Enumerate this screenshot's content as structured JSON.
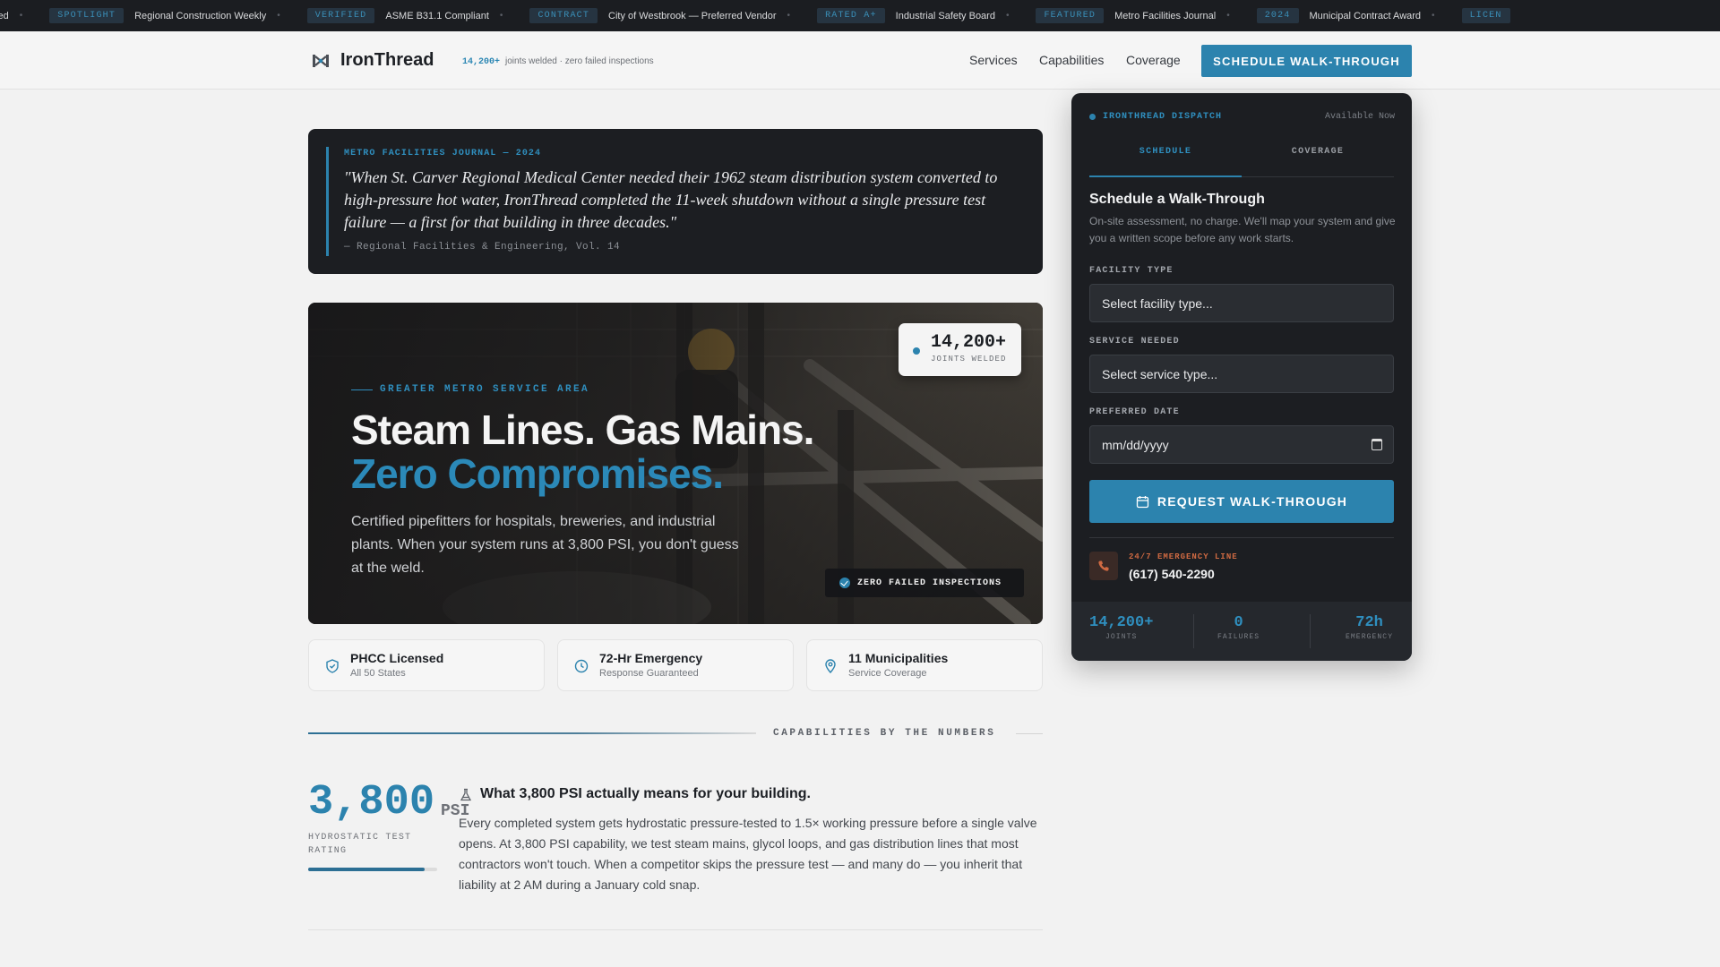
{
  "ticker": [
    {
      "tag": "",
      "text": "ved"
    },
    {
      "tag": "SPOTLIGHT",
      "text": "Regional Construction Weekly"
    },
    {
      "tag": "VERIFIED",
      "text": "ASME B31.1 Compliant"
    },
    {
      "tag": "CONTRACT",
      "text": "City of Westbrook — Preferred Vendor"
    },
    {
      "tag": "RATED A+",
      "text": "Industrial Safety Board"
    },
    {
      "tag": "FEATURED",
      "text": "Metro Facilities Journal"
    },
    {
      "tag": "2024",
      "text": "Municipal Contract Award"
    },
    {
      "tag": "LICEN",
      "text": ""
    }
  ],
  "header": {
    "brand": "IronThread",
    "stat_value": "14,200+",
    "stat_text": "joints welded · zero failed inspections",
    "nav": [
      "Services",
      "Capabilities",
      "Coverage"
    ],
    "cta": "SCHEDULE WALK-THROUGH"
  },
  "quote": {
    "label": "METRO FACILITIES JOURNAL — 2024",
    "text": "\"When St. Carver Regional Medical Center needed their 1962 steam distribution system converted to high-pressure hot water, IronThread completed the 11-week shutdown without a single pressure test failure — a first for that building in three decades.\"",
    "source": "— Regional Facilities & Engineering, Vol. 14"
  },
  "hero": {
    "eyebrow": "GREATER METRO SERVICE AREA",
    "headline_1": "Steam Lines. Gas Mains.",
    "headline_2": "Zero Compromises.",
    "body": "Certified pipefitters for hospitals, breweries, and industrial plants. When your system runs at 3,800 PSI, you don't guess at the weld.",
    "stat_value": "14,200+",
    "stat_label": "JOINTS WELDED",
    "badge": "ZERO FAILED INSPECTIONS"
  },
  "features": [
    {
      "icon": "shield-check-icon",
      "title": "PHCC Licensed",
      "sub": "All 50 States"
    },
    {
      "icon": "clock-icon",
      "title": "72-Hr Emergency",
      "sub": "Response Guaranteed"
    },
    {
      "icon": "map-pin-icon",
      "title": "11 Municipalities",
      "sub": "Service Coverage"
    }
  ],
  "capabilities": {
    "section_title": "CAPABILITIES BY THE NUMBERS",
    "big_number": "3,800",
    "unit": "PSI",
    "label": "HYDROSTATIC TEST RATING",
    "bar_fraction": 0.9,
    "heading": "What 3,800 PSI actually means for your building.",
    "body": "Every completed system gets hydrostatic pressure-tested to 1.5× working pressure before a single valve opens. At 3,800 PSI capability, we test steam mains, glycol loops, and gas distribution lines that most contractors won't touch. When a competitor skips the pressure test — and many do — you inherit that liability at 2 AM during a January cold snap."
  },
  "dispatch": {
    "title": "IRONTHREAD DISPATCH",
    "status": "Available Now",
    "tabs": [
      "SCHEDULE",
      "COVERAGE"
    ],
    "heading": "Schedule a Walk-Through",
    "sub": "On-site assessment, no charge. We'll map your system and give you a written scope before any work starts.",
    "facility_label": "FACILITY TYPE",
    "facility_value": "Select facility type...",
    "service_label": "SERVICE NEEDED",
    "service_value": "Select service type...",
    "date_label": "PREFERRED DATE",
    "date_value": "mm/dd/yyyy",
    "cta": "REQUEST WALK-THROUGH",
    "emergency_label": "24/7 EMERGENCY LINE",
    "emergency_phone": "(617) 540-2290",
    "stats": [
      {
        "value": "14,200+",
        "label": "JOINTS"
      },
      {
        "value": "0",
        "label": "FAILURES"
      },
      {
        "value": "72h",
        "label": "EMERGENCY"
      }
    ]
  },
  "colors": {
    "accent": "#2c83ae",
    "dark": "#1c1e22",
    "emergency": "#d06a42"
  }
}
